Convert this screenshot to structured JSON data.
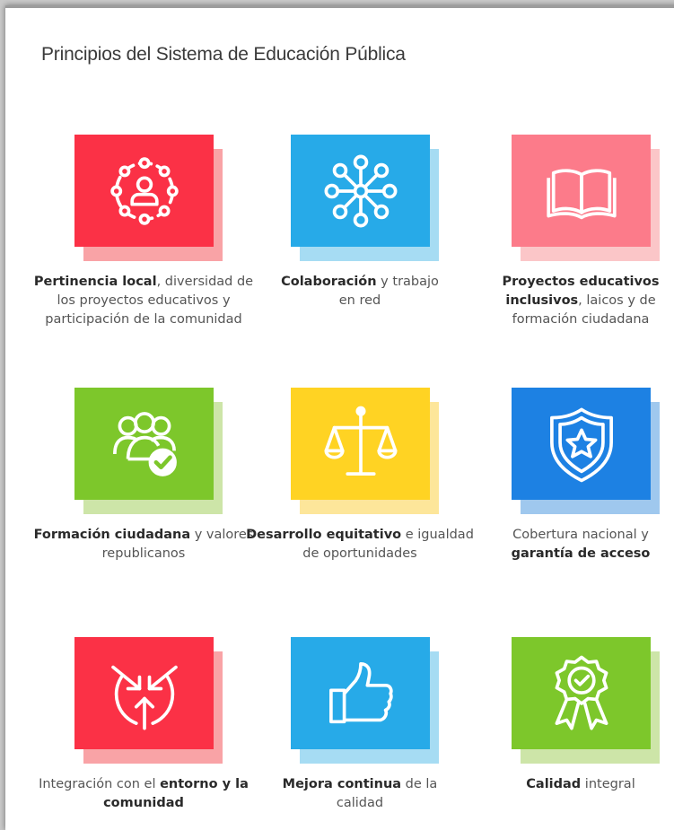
{
  "page": {
    "title": "Principios del Sistema de Educación Pública"
  },
  "colors": {
    "red": "#fb3146",
    "red_shadow": "#f9a3a6",
    "blue": "#27aae8",
    "blue_shadow": "#a6dcf3",
    "pink": "#fc7b8a",
    "pink_shadow": "#fbc6c8",
    "green": "#7dc72b",
    "green_shadow": "#cde5a8",
    "yellow": "#ffd323",
    "yellow_shadow": "#fde69a",
    "navy": "#1d81e3",
    "navy_shadow": "#9fc8ee"
  },
  "cards": [
    {
      "icon": "community-circle-icon",
      "color": "red",
      "bold1": "Pertinencia local",
      "text1": ", diversidad de los proyectos educativos y participación de la comunidad",
      "bold2": "",
      "text2": ""
    },
    {
      "icon": "network-icon",
      "color": "blue",
      "bold1": "Colaboración",
      "text1": " y trabajo en red",
      "bold2": "",
      "text2": ""
    },
    {
      "icon": "open-book-icon",
      "color": "pink",
      "bold1": "Proyectos educativos inclusivos",
      "text1": ", laicos y de formación ciudadana",
      "bold2": "",
      "text2": ""
    },
    {
      "icon": "group-check-icon",
      "color": "green",
      "bold1": "Formación ciudadana",
      "text1": " y valores republicanos",
      "bold2": "",
      "text2": ""
    },
    {
      "icon": "balance-scale-icon",
      "color": "yellow",
      "bold1": "Desarrollo equitativo",
      "text1": " e igualdad de oportunidades",
      "bold2": "",
      "text2": ""
    },
    {
      "icon": "shield-star-icon",
      "color": "navy",
      "bold1": "",
      "text1": "Cobertura nacional y ",
      "bold2": "garantía de acceso",
      "text2": ""
    },
    {
      "icon": "converging-arrows-icon",
      "color": "red",
      "bold1": "",
      "text1": "Integración con el ",
      "bold2": "entorno y la comunidad",
      "text2": ""
    },
    {
      "icon": "thumbs-up-icon",
      "color": "blue",
      "bold1": "Mejora continua",
      "text1": " de la calidad",
      "bold2": "",
      "text2": ""
    },
    {
      "icon": "award-ribbon-icon",
      "color": "green",
      "bold1": "Calidad",
      "text1": " integral",
      "bold2": "",
      "text2": ""
    }
  ]
}
